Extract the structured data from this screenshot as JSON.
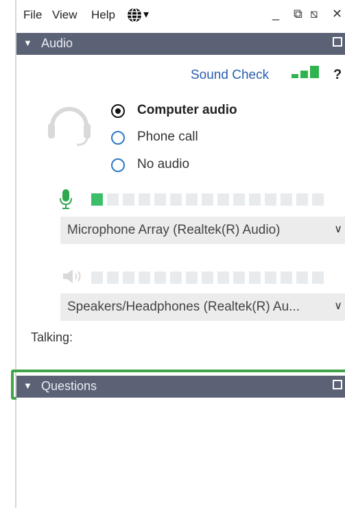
{
  "menu": {
    "file": "File",
    "view": "View",
    "help": "Help",
    "language_icon": "globe-icon",
    "dropdown_caret": "▾"
  },
  "window_controls": {
    "minimize": "_",
    "restore": "⧉",
    "popout": "⧅",
    "close": "✕"
  },
  "audio_panel": {
    "title": "Audio",
    "sound_check": "Sound Check",
    "help_symbol": "?",
    "signal_bars": {
      "active": 3,
      "total": 3
    },
    "options": [
      {
        "label": "Computer audio",
        "selected": true
      },
      {
        "label": "Phone call",
        "selected": false
      },
      {
        "label": "No audio",
        "selected": false
      }
    ],
    "microphone": {
      "level": 1,
      "segments": 15,
      "device": "Microphone Array (Realtek(R) Audio)"
    },
    "speaker": {
      "level": 0,
      "segments": 15,
      "device": "Speakers/Headphones  (Realtek(R)  Au..."
    },
    "talking_label": "Talking:"
  },
  "questions_panel": {
    "title": "Questions"
  },
  "colors": {
    "header_bg": "#5b6275",
    "accent_blue": "#2a5db0",
    "level_green": "#3dbf69",
    "signal_green": "#2fb34f",
    "highlight_frame": "#42a448"
  }
}
